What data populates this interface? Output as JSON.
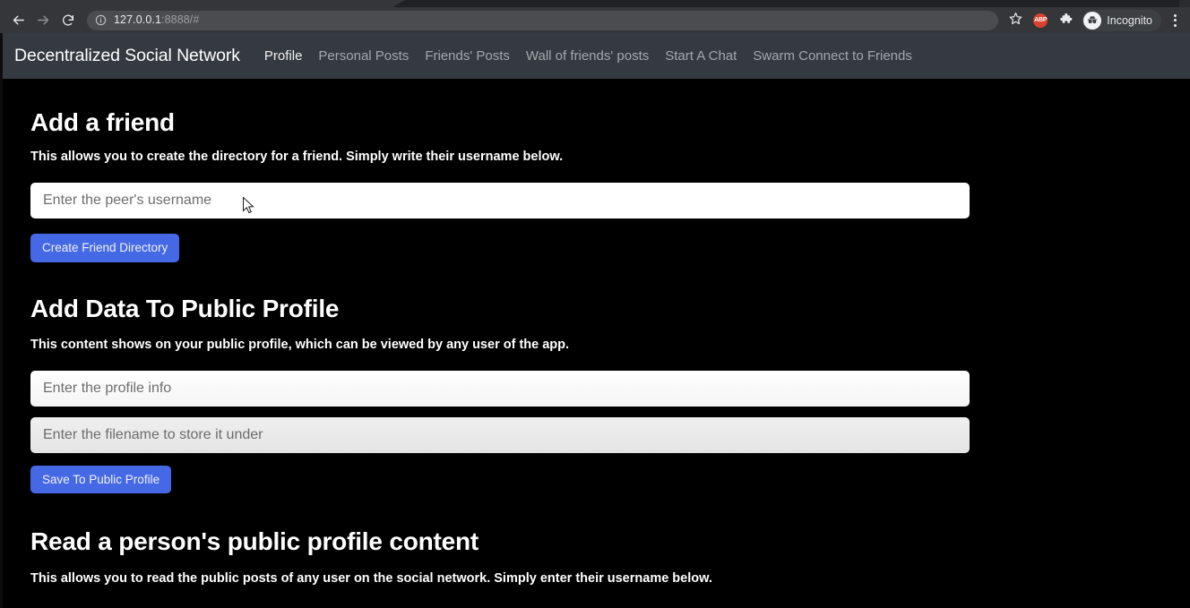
{
  "browser": {
    "back_icon": "back-arrow-icon",
    "forward_icon": "forward-arrow-icon",
    "reload_icon": "reload-icon",
    "omnibox": {
      "security_icon": "info-circle-icon",
      "url_host": "127.0.0.1",
      "url_rest": ":8888/#"
    },
    "bookmark_icon": "star-icon",
    "extension_abp_label": "ABP",
    "extensions_icon": "puzzle-piece-icon",
    "incognito_label": "Incognito",
    "incognito_icon": "incognito-avatar-icon",
    "menu_icon": "three-dot-menu-icon"
  },
  "app": {
    "brand": "Decentralized Social Network",
    "nav": [
      {
        "label": "Profile",
        "active": true
      },
      {
        "label": "Personal Posts",
        "active": false
      },
      {
        "label": "Friends' Posts",
        "active": false
      },
      {
        "label": "Wall of friends' posts",
        "active": false
      },
      {
        "label": "Start A Chat",
        "active": false
      },
      {
        "label": "Swarm Connect to Friends",
        "active": false
      }
    ]
  },
  "sections": {
    "add_friend": {
      "title": "Add a friend",
      "description": "This allows you to create the directory for a friend. Simply write their username below.",
      "username_placeholder": "Enter the peer's username",
      "username_value": "",
      "button_label": "Create Friend Directory"
    },
    "add_profile_data": {
      "title": "Add Data To Public Profile",
      "description": "This content shows on your public profile, which can be viewed by any user of the app.",
      "info_placeholder": "Enter the profile info",
      "info_value": "",
      "filename_placeholder": "Enter the filename to store it under",
      "filename_value": "",
      "button_label": "Save To Public Profile"
    },
    "read_profile": {
      "title": "Read a person's public profile content",
      "description": "This allows you to read the public posts of any user on the social network. Simply enter their username below."
    }
  },
  "colors": {
    "navbar_bg": "#343a40",
    "page_bg": "#000000",
    "primary_button": "#4569e4",
    "browser_toolbar": "#35363a",
    "omnibox_bg": "#4b4c4f",
    "abp_badge": "#d9422b"
  }
}
